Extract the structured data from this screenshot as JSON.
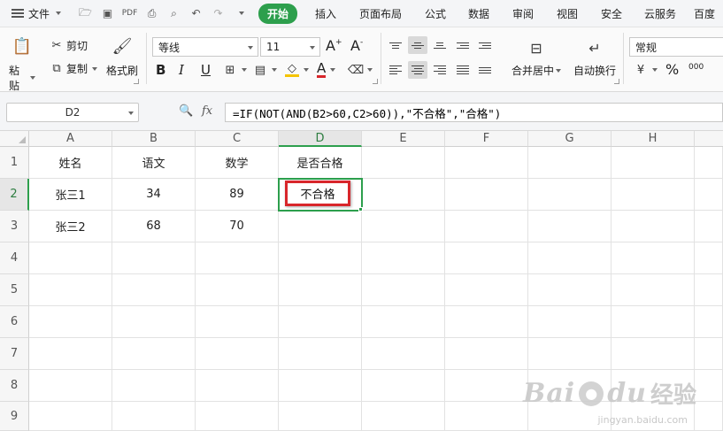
{
  "menubar": {
    "file_label": "文件",
    "tabs": [
      "开始",
      "插入",
      "页面布局",
      "公式",
      "数据",
      "审阅",
      "视图",
      "安全",
      "云服务",
      "百度"
    ]
  },
  "ribbon": {
    "paste_label": "粘贴",
    "cut_label": "剪切",
    "copy_label": "复制",
    "format_painter_label": "格式刷",
    "font_name": "等线",
    "font_size": "11",
    "merge_label": "合并居中",
    "wrap_label": "自动换行",
    "number_format": "常规",
    "bold": "B",
    "italic": "I",
    "underline": "U",
    "font_color_letter": "A",
    "increase_font": "A⁺",
    "decrease_font": "A⁻",
    "percent": "%",
    "thousands": "000",
    "accent_color": "#2d9f4d",
    "font_color": "#d8262b"
  },
  "formula_bar": {
    "name_box": "D2",
    "fx_label": "fx",
    "formula": "=IF(NOT(AND(B2>60,C2>60)),\"不合格\",\"合格\")"
  },
  "sheet": {
    "columns": [
      "A",
      "B",
      "C",
      "D",
      "E",
      "F",
      "G",
      "H"
    ],
    "rows": [
      "1",
      "2",
      "3",
      "4",
      "5",
      "6",
      "7",
      "8",
      "9"
    ],
    "cells": [
      [
        "姓名",
        "语文",
        "数学",
        "是否合格"
      ],
      [
        "张三1",
        "34",
        "89",
        "不合格"
      ],
      [
        "张三2",
        "68",
        "70",
        ""
      ]
    ],
    "selected_cell": "D2",
    "highlight_color": "#d8262b"
  },
  "watermark": {
    "brand": "Bai",
    "brand_suffix": "du",
    "cn": "经验",
    "url": "jingyan.baidu.com"
  }
}
